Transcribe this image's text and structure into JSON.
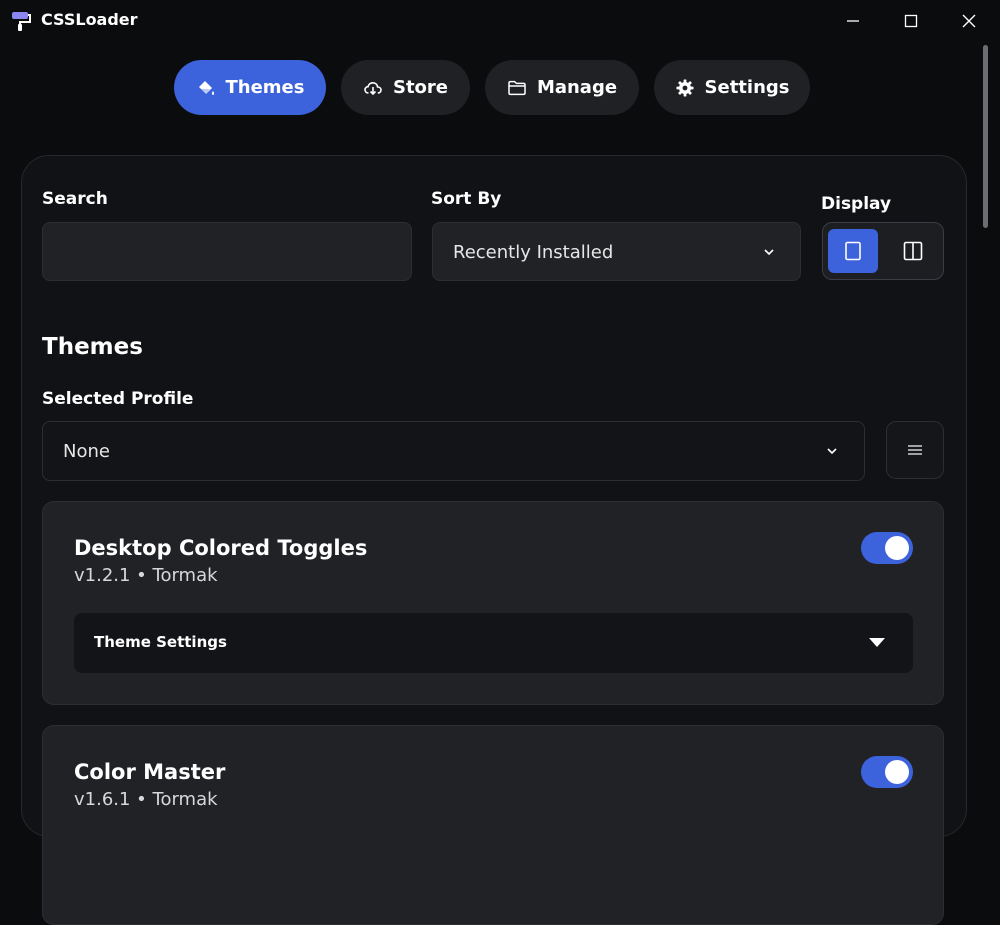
{
  "window": {
    "title": "CSSLoader",
    "controls": [
      "minimize-icon",
      "maximize-icon",
      "close-icon"
    ]
  },
  "nav": {
    "tabs": [
      {
        "label": "Themes",
        "icon": "paint-bucket-icon",
        "active": true
      },
      {
        "label": "Store",
        "icon": "cloud-download-icon",
        "active": false
      },
      {
        "label": "Manage",
        "icon": "folder-icon",
        "active": false
      },
      {
        "label": "Settings",
        "icon": "gear-icon",
        "active": false
      }
    ]
  },
  "filters": {
    "search_label": "Search",
    "search_value": "",
    "search_placeholder": "",
    "sort_label": "Sort By",
    "sort_value": "Recently Installed",
    "display_label": "Display",
    "display_modes": [
      "single-column-icon",
      "two-column-icon"
    ],
    "display_selected": "single-column-icon"
  },
  "themes_section": {
    "title": "Themes",
    "profile_label": "Selected Profile",
    "profile_value": "None"
  },
  "theme_cards": [
    {
      "name": "Desktop Colored Toggles",
      "meta": "v1.2.1 • Tormak",
      "enabled": true,
      "settings_label": "Theme Settings"
    },
    {
      "name": "Color Master",
      "meta": "v1.6.1 • Tormak",
      "enabled": true
    }
  ],
  "colors": {
    "accent": "#3d63dc",
    "background": "#0b0c0e",
    "card": "#202226"
  }
}
